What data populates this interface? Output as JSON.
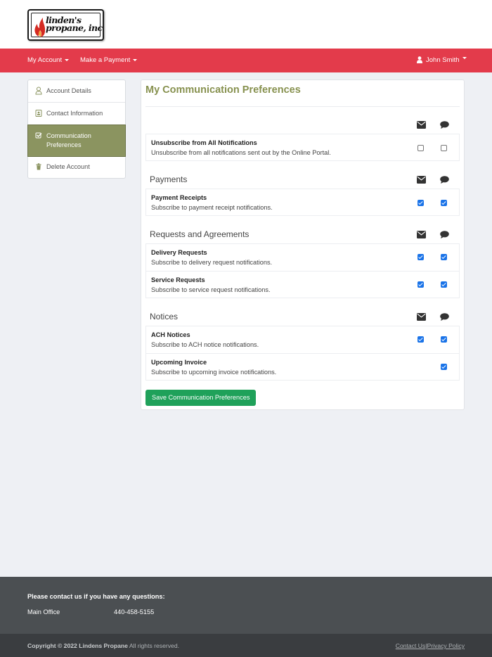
{
  "logo": {
    "line1": "linden's",
    "line2": "propane, inc"
  },
  "nav": {
    "my_account": "My Account",
    "make_payment": "Make a Payment",
    "user": "John Smith"
  },
  "sidebar": {
    "items": [
      {
        "label": "Account Details",
        "icon": "user-outline-icon"
      },
      {
        "label": "Contact Information",
        "icon": "contact-card-icon"
      },
      {
        "label": "Communication Preferences",
        "icon": "checkbox-icon"
      },
      {
        "label": "Delete Account",
        "icon": "trash-icon"
      }
    ]
  },
  "main": {
    "title": "My Communication Preferences",
    "unsubscribe": {
      "title": "Unsubscribe from All Notifications",
      "desc": "Unsubscribe from all notifications sent out by the Online Portal.",
      "email": false,
      "sms": false
    },
    "groups": [
      {
        "title": "Payments",
        "rows": [
          {
            "title": "Payment Receipts",
            "desc": "Subscribe to payment receipt notifications.",
            "email": true,
            "sms": true
          }
        ]
      },
      {
        "title": "Requests and Agreements",
        "rows": [
          {
            "title": "Delivery Requests",
            "desc": "Subscribe to delivery request notifications.",
            "email": true,
            "sms": true
          },
          {
            "title": "Service Requests",
            "desc": "Subscribe to service request notifications.",
            "email": true,
            "sms": true
          }
        ]
      },
      {
        "title": "Notices",
        "rows": [
          {
            "title": "ACH Notices",
            "desc": "Subscribe to ACH notice notifications.",
            "email": true,
            "sms": true
          },
          {
            "title": "Upcoming Invoice",
            "desc": "Subscribe to upcoming invoice notifications.",
            "email": null,
            "sms": true
          }
        ]
      }
    ],
    "save_label": "Save Communication Preferences"
  },
  "footer": {
    "heading": "Please contact us if you have any questions:",
    "office_label": "Main Office",
    "office_phone": "440-458-5155",
    "copyright_bold": "Copyright © 2022 Lindens Propane",
    "copyright_rest": " All rights reserved.",
    "contact_link": "Contact Us",
    "separator": "|",
    "privacy_link": "Privacy Policy"
  },
  "colors": {
    "navbar": "#e33b4b",
    "sidebar_active": "#8b9460",
    "title": "#87914f",
    "checkbox": "#1a73e8",
    "save_button": "#1fa15a"
  }
}
